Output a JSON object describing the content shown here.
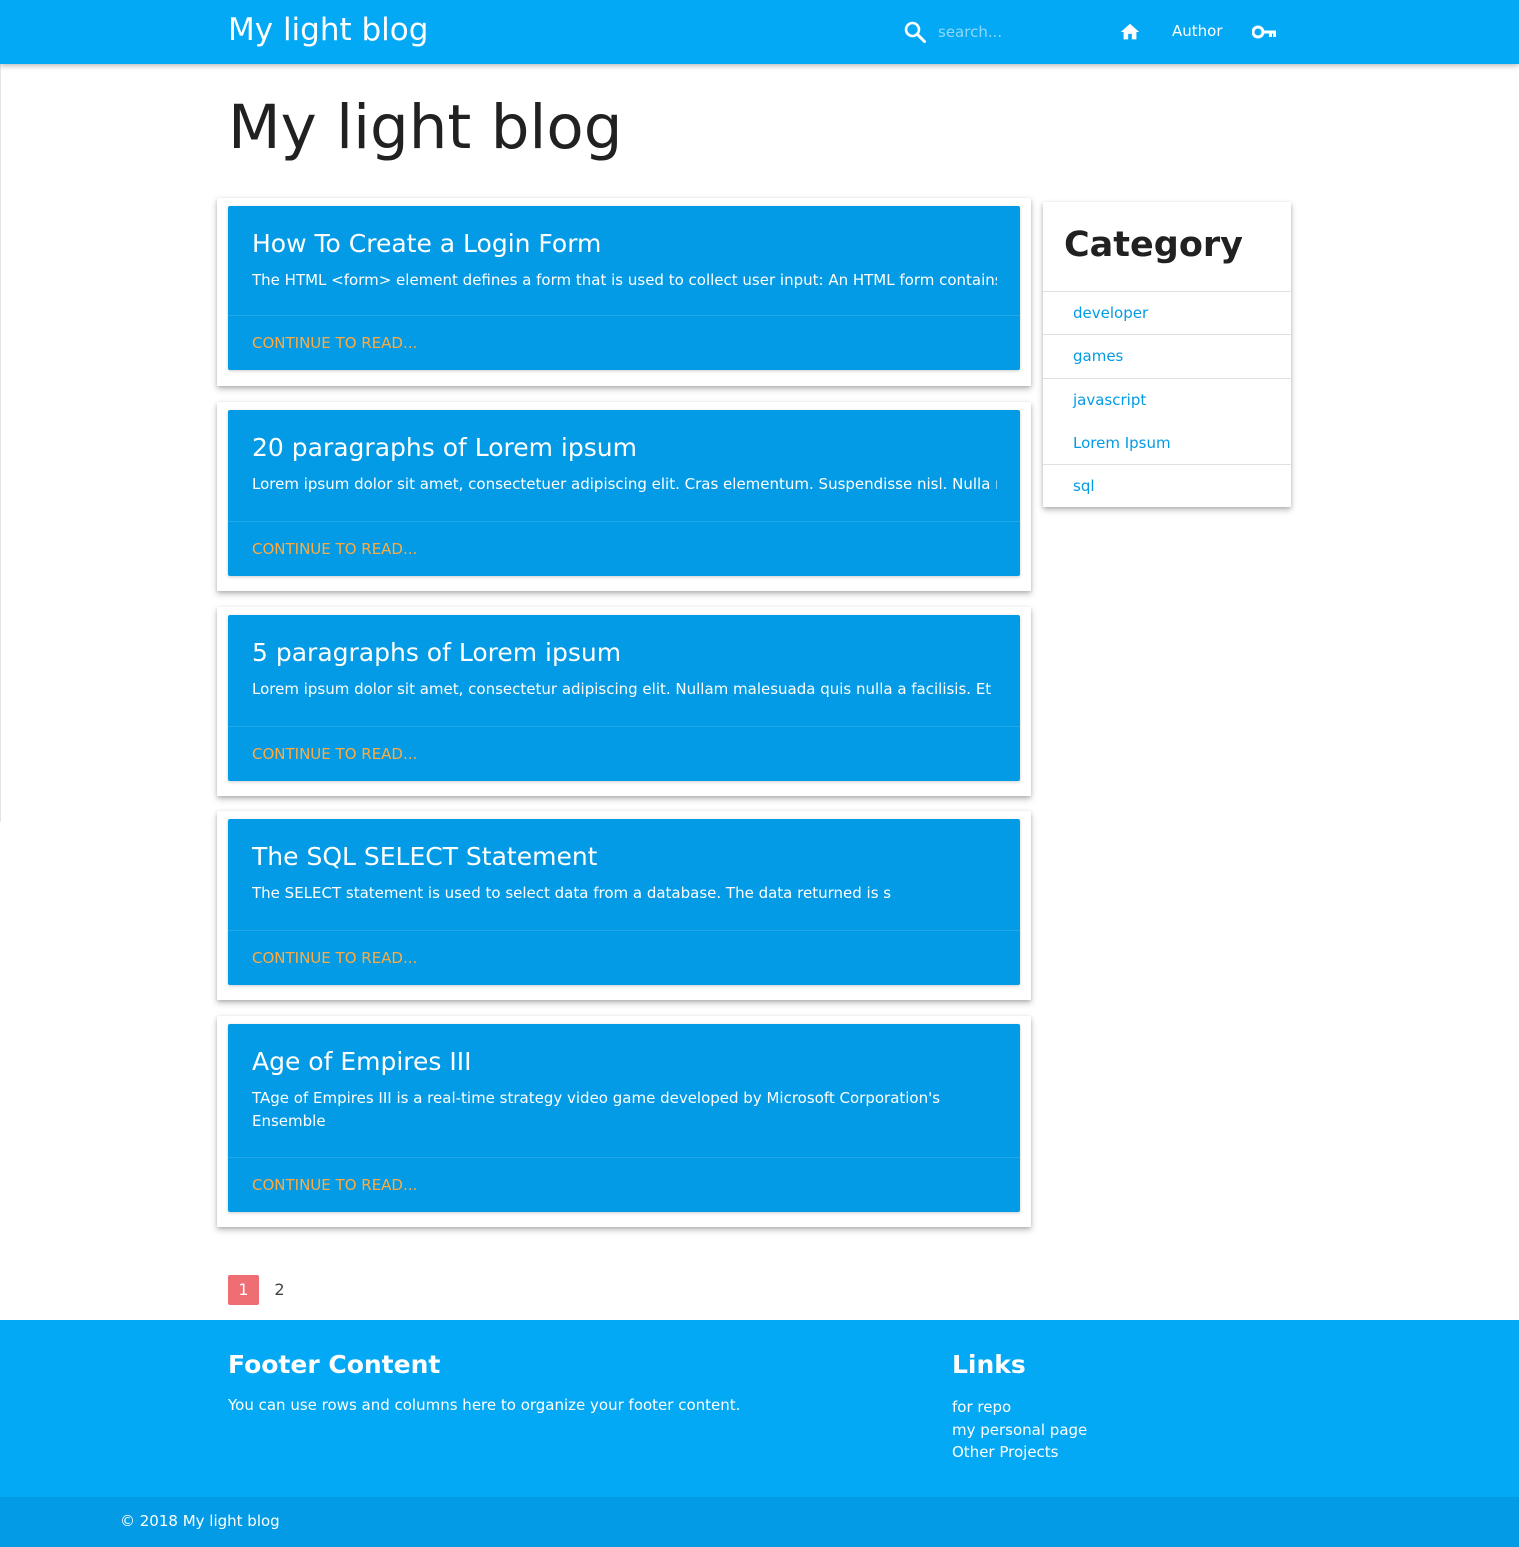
{
  "navbar": {
    "brand": "My light blog",
    "search_placeholder": "search...",
    "author_label": "Author"
  },
  "page": {
    "title": "My light blog"
  },
  "posts": [
    {
      "title": "How To Create a Login Form",
      "excerpt": "The HTML <form> element defines a form that is used to collect user input: An HTML form contains f",
      "link": "CONTINUE TO READ..."
    },
    {
      "title": "20 paragraphs of Lorem ipsum",
      "excerpt": "Lorem ipsum dolor sit amet, consectetuer adipiscing elit. Cras elementum. Suspendisse nisl. Nulla no",
      "link": "CONTINUE TO READ..."
    },
    {
      "title": "5 paragraphs of Lorem ipsum",
      "excerpt": "Lorem ipsum dolor sit amet, consectetur adipiscing elit. Nullam malesuada quis nulla a facilisis. Et",
      "link": "CONTINUE TO READ..."
    },
    {
      "title": "The SQL SELECT Statement",
      "excerpt": "The SELECT statement is used to select data from a database. The data returned is s",
      "link": "CONTINUE TO READ..."
    },
    {
      "title": "Age of Empires III",
      "excerpt": "TAge of Empires III is a real-time strategy video game developed by Microsoft Corporation's Ensemble",
      "link": "CONTINUE TO READ..."
    }
  ],
  "sidebar": {
    "title": "Category",
    "categories": [
      "developer",
      "games",
      "javascript",
      "Lorem Ipsum",
      "sql"
    ]
  },
  "pagination": {
    "pages": [
      "1",
      "2"
    ],
    "active": "1"
  },
  "footer": {
    "content_title": "Footer Content",
    "content_text": "You can use rows and columns here to organize your footer content.",
    "links_title": "Links",
    "links": [
      "for repo",
      "my personal page",
      "Other Projects"
    ],
    "copyright": "© 2018 My light blog"
  },
  "colors": {
    "primary": "#03a9f4",
    "card": "#039be5",
    "link_accent": "#ffab40",
    "active_page": "#ee6e73"
  },
  "icons": [
    "search-icon",
    "home-icon",
    "key-icon"
  ]
}
